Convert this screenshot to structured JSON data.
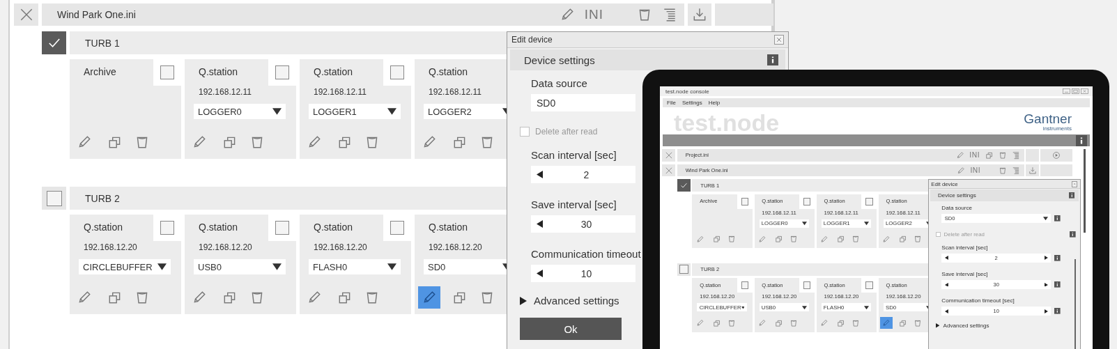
{
  "large_view": {
    "files": [
      {
        "name": "Wind Park One.ini",
        "actions": [
          {
            "kind": "edit"
          },
          {
            "kind": "ini",
            "label": "INI"
          },
          {
            "kind": "gap"
          },
          {
            "kind": "delete"
          },
          {
            "kind": "list"
          }
        ],
        "slots": [
          {
            "kind": "download"
          },
          {
            "kind": "empty"
          }
        ]
      }
    ],
    "groups": [
      {
        "name": "TURB 1",
        "checked": true,
        "devices": [
          {
            "name": "Archive",
            "checked": false,
            "editing": false
          },
          {
            "name": "Q.station",
            "ip": "192.168.12.11",
            "source": "LOGGER0",
            "checked": false,
            "editing": false
          },
          {
            "name": "Q.station",
            "ip": "192.168.12.11",
            "source": "LOGGER1",
            "checked": false,
            "editing": false
          },
          {
            "name": "Q.station",
            "ip": "192.168.12.11",
            "source": "LOGGER2",
            "editing": false
          }
        ]
      },
      {
        "name": "TURB 2",
        "checked": false,
        "devices": [
          {
            "name": "Q.station",
            "ip": "192.168.12.20",
            "source": "CIRCLEBUFFER",
            "checked": false,
            "editing": false
          },
          {
            "name": "Q.station",
            "ip": "192.168.12.20",
            "source": "USB0",
            "checked": false,
            "editing": false
          },
          {
            "name": "Q.station",
            "ip": "192.168.12.20",
            "source": "FLASH0",
            "checked": false,
            "editing": false
          },
          {
            "name": "Q.station",
            "ip": "192.168.12.20",
            "source": "SD0",
            "editing": true
          }
        ]
      }
    ],
    "edit_panel": {
      "title": "Edit device",
      "section": "Device settings",
      "fields": [
        {
          "kind": "dropdown",
          "label": "Data source",
          "value": "SD0",
          "info": false
        },
        {
          "kind": "checkbox",
          "label": "Delete after read",
          "checked": false,
          "disabled": true,
          "info": false
        },
        {
          "kind": "spinner",
          "label": "Scan interval [sec]",
          "value": "2",
          "info": false
        },
        {
          "kind": "spinner",
          "label": "Save interval [sec]",
          "value": "30",
          "info": false
        },
        {
          "kind": "spinner",
          "label": "Communication timeout",
          "value": "10",
          "info": false
        }
      ],
      "advanced": {
        "label": "Advanced settings",
        "expanded": false
      },
      "ok_button": "Ok"
    }
  },
  "laptop_screen": {
    "window_title": "test.node console",
    "menu": [
      "File",
      "Settings",
      "Help"
    ],
    "logo": "test.node",
    "brand": {
      "name": "Gantner",
      "tagline": "instruments"
    },
    "files": [
      {
        "name": "Project.ini",
        "actions": [
          {
            "kind": "edit"
          },
          {
            "kind": "ini",
            "label": "INI"
          },
          {
            "kind": "copy"
          },
          {
            "kind": "delete"
          },
          {
            "kind": "list"
          }
        ],
        "slots": [
          {
            "kind": "empty"
          },
          {
            "kind": "play"
          }
        ]
      },
      {
        "name": "Wind Park One.ini",
        "actions": [
          {
            "kind": "edit"
          },
          {
            "kind": "ini",
            "label": "INI"
          },
          {
            "kind": "gap"
          },
          {
            "kind": "delete"
          },
          {
            "kind": "list"
          }
        ],
        "slots": [
          {
            "kind": "download"
          },
          {
            "kind": "empty"
          }
        ]
      }
    ],
    "groups": [
      {
        "name": "TURB 1",
        "checked": true,
        "devices": [
          {
            "name": "Archive",
            "checked": false,
            "editing": false
          },
          {
            "name": "Q.station",
            "ip": "192.168.12.11",
            "source": "LOGGER0",
            "checked": false,
            "editing": false
          },
          {
            "name": "Q.station",
            "ip": "192.168.12.11",
            "source": "LOGGER1",
            "checked": false,
            "editing": false
          },
          {
            "name": "Q.station",
            "ip": "192.168.12.11",
            "source": "LOGGER2",
            "editing": false
          }
        ]
      },
      {
        "name": "TURB 2",
        "checked": false,
        "devices": [
          {
            "name": "Q.station",
            "ip": "192.168.12.20",
            "source": "CIRCLEBUFFER",
            "checked": false,
            "editing": false
          },
          {
            "name": "Q.station",
            "ip": "192.168.12.20",
            "source": "USB0",
            "checked": false,
            "editing": false
          },
          {
            "name": "Q.station",
            "ip": "192.168.12.20",
            "source": "FLASH0",
            "checked": false,
            "editing": false
          },
          {
            "name": "Q.station",
            "ip": "192.168.12.20",
            "source": "SD0",
            "editing": true
          }
        ]
      }
    ],
    "edit_panel": {
      "title": "Edit device",
      "section": "Device settings",
      "fields": [
        {
          "kind": "dropdown",
          "label": "Data source",
          "value": "SD0",
          "info": true
        },
        {
          "kind": "checkbox",
          "label": "Delete after read",
          "checked": false,
          "disabled": true,
          "info": true
        },
        {
          "kind": "spinner",
          "label": "Scan interval [sec]",
          "value": "2",
          "info": true
        },
        {
          "kind": "spinner",
          "label": "Save interval [sec]",
          "value": "30",
          "info": true
        },
        {
          "kind": "spinner",
          "label": "Communication timeout [sec]",
          "value": "10",
          "info": true
        }
      ],
      "advanced": {
        "label": "Advanced settings",
        "expanded": false
      }
    }
  }
}
